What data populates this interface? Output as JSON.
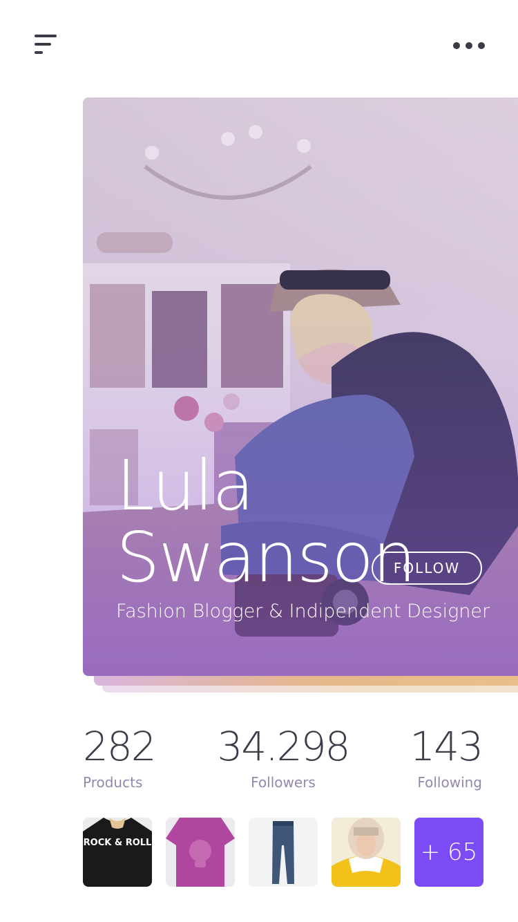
{
  "header": {
    "menu_icon": "hamburger-menu-icon",
    "more_icon": "more-horizontal-icon"
  },
  "profile": {
    "first_name": "Lula",
    "last_name": "Swanson",
    "follow_label": "FOLLOW",
    "subtitle": "Fashion Blogger & Indipendent Designer"
  },
  "stats": [
    {
      "value": "282",
      "label": "Products"
    },
    {
      "value": "34.298",
      "label": "Followers"
    },
    {
      "value": "143",
      "label": "Following"
    }
  ],
  "products": {
    "more_label": "+ 65",
    "thumbnail_1_print": "ROCK & ROLL"
  },
  "colors": {
    "accent": "#7b4cf5",
    "text_dark": "#3c3c4a",
    "label_muted": "#9487ad"
  }
}
